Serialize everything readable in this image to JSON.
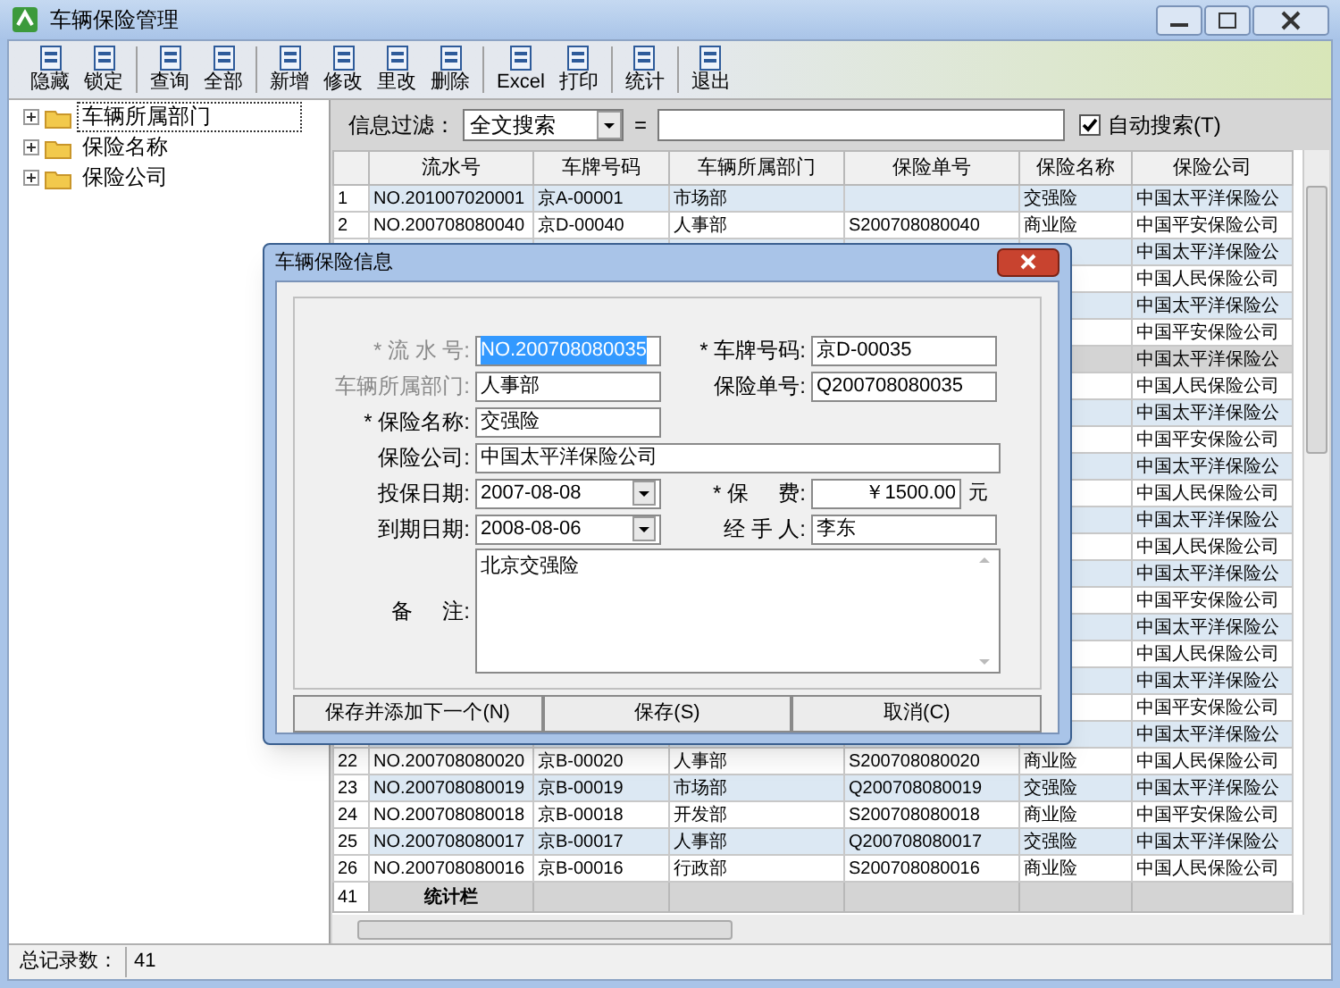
{
  "window": {
    "title": "车辆保险管理"
  },
  "toolbar": [
    {
      "label": "隐藏",
      "separator_before": false
    },
    {
      "label": "锁定",
      "separator_before": false
    },
    {
      "label": "查询",
      "separator_before": true
    },
    {
      "label": "全部",
      "separator_before": false
    },
    {
      "label": "新增",
      "separator_before": true
    },
    {
      "label": "修改",
      "separator_before": false
    },
    {
      "label": "里改",
      "separator_before": false
    },
    {
      "label": "删除",
      "separator_before": false
    },
    {
      "label": "Excel",
      "separator_before": true
    },
    {
      "label": "打印",
      "separator_before": false
    },
    {
      "label": "统计",
      "separator_before": true
    },
    {
      "label": "退出",
      "separator_before": true
    }
  ],
  "tree": [
    {
      "label": "车辆所属部门",
      "selected": true,
      "expanded": false
    },
    {
      "label": "保险名称",
      "selected": false,
      "expanded": false
    },
    {
      "label": "保险公司",
      "selected": false,
      "expanded": false
    }
  ],
  "filter": {
    "label": "信息过滤：",
    "field": "全文搜索",
    "equals": "=",
    "auto_search": {
      "label": "自动搜索(T)",
      "checked": true
    }
  },
  "table": {
    "columns": [
      "流水号",
      "车牌号码",
      "车辆所属部门",
      "保险单号",
      "保险名称",
      "保险公司"
    ],
    "rows": [
      {
        "number": "1",
        "cells": [
          "NO.201007020001",
          "京A-00001",
          "市场部",
          null,
          "交强险",
          "中国太平洋保险公"
        ],
        "selected": false
      },
      {
        "number": "2",
        "cells": [
          "NO.200708080040",
          "京D-00040",
          "人事部",
          "S200708080040",
          "商业险",
          "中国平安保险公司"
        ],
        "selected": false
      },
      {
        "number": null,
        "cells": [
          null,
          null,
          null,
          null,
          null,
          "中国太平洋保险公"
        ],
        "selected": false
      },
      {
        "number": null,
        "cells": [
          null,
          null,
          null,
          null,
          null,
          "中国人民保险公司"
        ],
        "selected": false
      },
      {
        "number": null,
        "cells": [
          null,
          null,
          null,
          null,
          null,
          "中国太平洋保险公"
        ],
        "selected": false
      },
      {
        "number": null,
        "cells": [
          null,
          null,
          null,
          null,
          null,
          "中国平安保险公司"
        ],
        "selected": false
      },
      {
        "number": null,
        "cells": [
          null,
          null,
          null,
          null,
          null,
          "中国太平洋保险公"
        ],
        "selected": true
      },
      {
        "number": null,
        "cells": [
          null,
          null,
          null,
          null,
          null,
          "中国人民保险公司"
        ],
        "selected": false
      },
      {
        "number": null,
        "cells": [
          null,
          null,
          null,
          null,
          null,
          "中国太平洋保险公"
        ],
        "selected": false
      },
      {
        "number": null,
        "cells": [
          null,
          null,
          null,
          null,
          null,
          "中国平安保险公司"
        ],
        "selected": false
      },
      {
        "number": null,
        "cells": [
          null,
          null,
          null,
          null,
          null,
          "中国太平洋保险公"
        ],
        "selected": false
      },
      {
        "number": null,
        "cells": [
          null,
          null,
          null,
          null,
          null,
          "中国人民保险公司"
        ],
        "selected": false
      },
      {
        "number": null,
        "cells": [
          null,
          null,
          null,
          null,
          null,
          "中国太平洋保险公"
        ],
        "selected": false
      },
      {
        "number": null,
        "cells": [
          null,
          null,
          null,
          null,
          null,
          "中国人民保险公司"
        ],
        "selected": false
      },
      {
        "number": null,
        "cells": [
          null,
          null,
          null,
          null,
          null,
          "中国太平洋保险公"
        ],
        "selected": false
      },
      {
        "number": null,
        "cells": [
          null,
          null,
          null,
          null,
          null,
          "中国平安保险公司"
        ],
        "selected": false
      },
      {
        "number": null,
        "cells": [
          null,
          null,
          null,
          null,
          null,
          "中国太平洋保险公"
        ],
        "selected": false
      },
      {
        "number": null,
        "cells": [
          null,
          null,
          null,
          null,
          null,
          "中国人民保险公司"
        ],
        "selected": false
      },
      {
        "number": null,
        "cells": [
          null,
          null,
          null,
          null,
          null,
          "中国太平洋保险公"
        ],
        "selected": false
      },
      {
        "number": null,
        "cells": [
          null,
          null,
          null,
          null,
          null,
          "中国平安保险公司"
        ],
        "selected": false
      },
      {
        "number": null,
        "cells": [
          null,
          null,
          null,
          null,
          null,
          "中国太平洋保险公"
        ],
        "selected": false
      },
      {
        "number": "22",
        "cells": [
          "NO.200708080020",
          "京B-00020",
          "人事部",
          "S200708080020",
          "商业险",
          "中国人民保险公司"
        ],
        "selected": false
      },
      {
        "number": "23",
        "cells": [
          "NO.200708080019",
          "京B-00019",
          "市场部",
          "Q200708080019",
          "交强险",
          "中国太平洋保险公"
        ],
        "selected": false
      },
      {
        "number": "24",
        "cells": [
          "NO.200708080018",
          "京B-00018",
          "开发部",
          "S200708080018",
          "商业险",
          "中国平安保险公司"
        ],
        "selected": false
      },
      {
        "number": "25",
        "cells": [
          "NO.200708080017",
          "京B-00017",
          "人事部",
          "Q200708080017",
          "交强险",
          "中国太平洋保险公"
        ],
        "selected": false
      },
      {
        "number": "26",
        "cells": [
          "NO.200708080016",
          "京B-00016",
          "行政部",
          "S200708080016",
          "商业险",
          "中国人民保险公司"
        ],
        "selected": false
      }
    ],
    "summary": {
      "number": "41",
      "label": "统计栏"
    }
  },
  "dialog": {
    "title": "车辆保险信息",
    "rows": [
      [
        {
          "label": "* 流 水 号:",
          "value": "NO.200708080035",
          "kind": "text",
          "label_disabled": true,
          "value_selected": true
        },
        {
          "label": "* 车牌号码:",
          "value": "京D-00035",
          "kind": "text",
          "label_disabled": false,
          "value_selected": false
        }
      ],
      [
        {
          "label": "车辆所属部门:",
          "value": "人事部",
          "kind": "text",
          "label_disabled": true,
          "value_selected": false
        },
        {
          "label": "保险单号:",
          "value": "Q200708080035",
          "kind": "text",
          "label_disabled": false,
          "value_selected": false
        }
      ],
      [
        {
          "label": "* 保险名称:",
          "value": "交强险",
          "kind": "text",
          "label_disabled": false,
          "value_selected": false
        }
      ],
      [
        {
          "label": "保险公司:",
          "value": "中国太平洋保险公司",
          "kind": "wide",
          "label_disabled": false,
          "value_selected": false
        }
      ],
      [
        {
          "label": "投保日期:",
          "value": "2007-08-08",
          "kind": "combo",
          "label_disabled": false,
          "value_selected": false
        },
        {
          "label": "* 保     费:",
          "value": "￥1500.00",
          "kind": "money",
          "suffix": "元",
          "label_disabled": false,
          "value_selected": false
        }
      ],
      [
        {
          "label": "到期日期:",
          "value": "2008-08-06",
          "kind": "combo",
          "label_disabled": false,
          "value_selected": false
        },
        {
          "label": "经 手 人:",
          "value": "李东",
          "kind": "text",
          "label_disabled": false,
          "value_selected": false
        }
      ],
      [
        {
          "label": "备     注:",
          "value": "北京交强险",
          "kind": "memo",
          "label_disabled": false,
          "value_selected": false
        }
      ]
    ],
    "buttons": [
      "保存并添加下一个(N)",
      "保存(S)",
      "取消(C)"
    ]
  },
  "status_bar": {
    "label": "总记录数：",
    "value": "41"
  }
}
